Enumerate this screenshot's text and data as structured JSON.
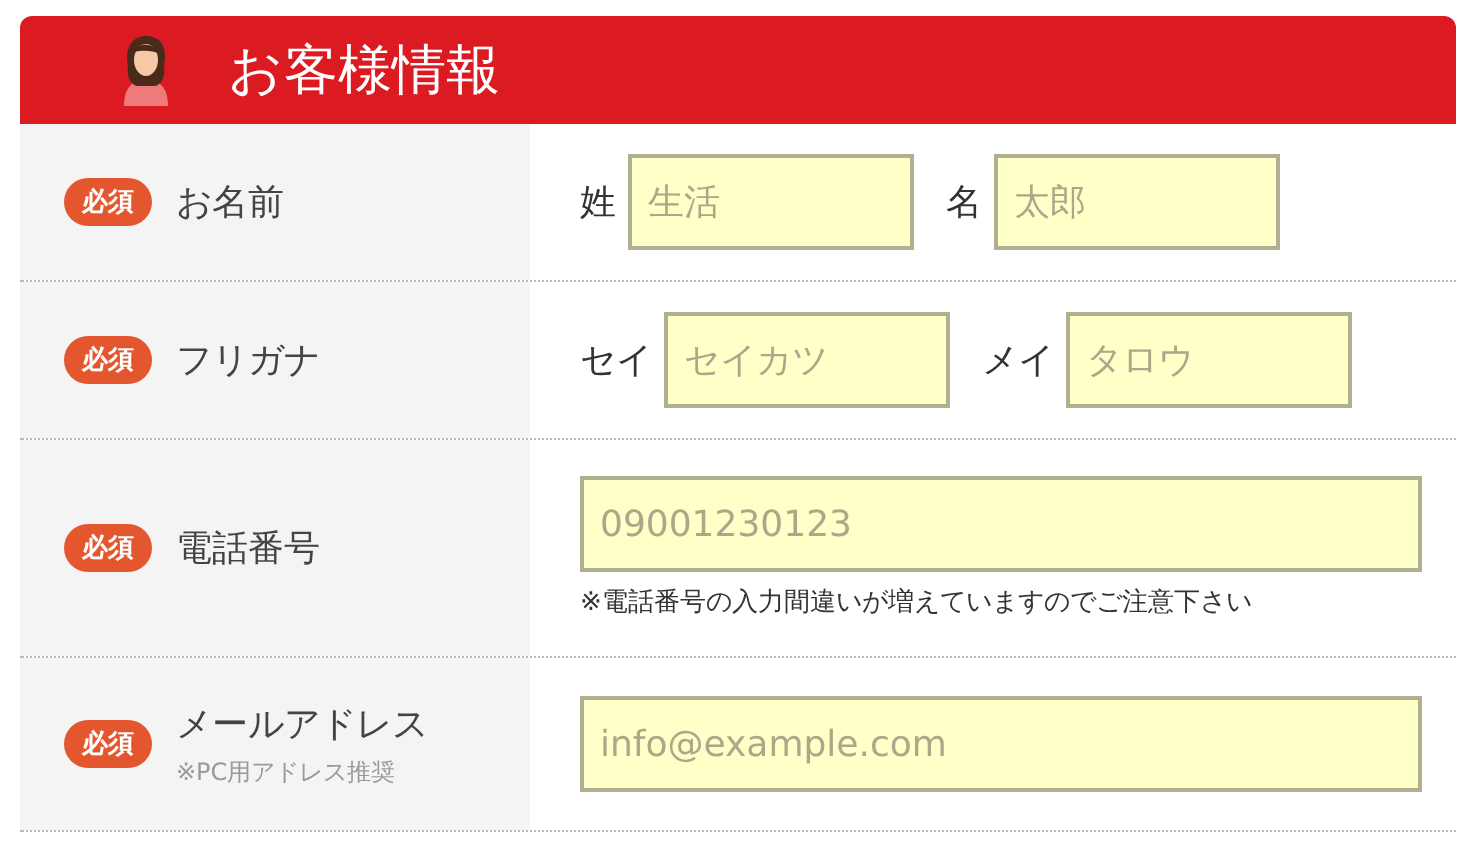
{
  "header": {
    "title": "お客様情報"
  },
  "rows": [
    {
      "kind": "split",
      "badge": "必須",
      "label": "お名前",
      "fields": [
        {
          "prefix": "姓",
          "placeholder": "生活"
        },
        {
          "prefix": "名",
          "placeholder": "太郎"
        }
      ]
    },
    {
      "kind": "split",
      "badge": "必須",
      "label": "フリガナ",
      "fields": [
        {
          "prefix": "セイ",
          "placeholder": "セイカツ"
        },
        {
          "prefix": "メイ",
          "placeholder": "タロウ"
        }
      ]
    },
    {
      "kind": "single",
      "badge": "必須",
      "label": "電話番号",
      "placeholder": "09001230123",
      "note": "※電話番号の入力間違いが増えていますのでご注意下さい"
    },
    {
      "kind": "single",
      "badge": "必須",
      "label": "メールアドレス",
      "sublabel": "※PC用アドレス推奨",
      "placeholder": "info@example.com"
    }
  ]
}
